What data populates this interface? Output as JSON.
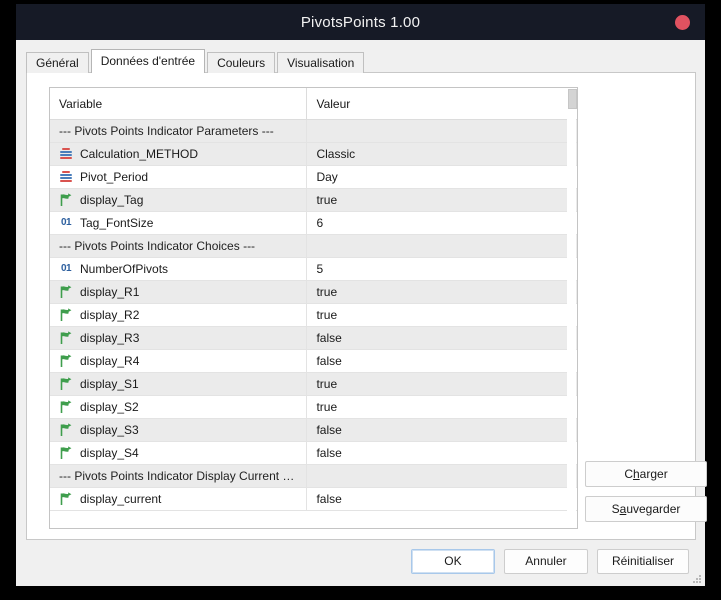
{
  "window": {
    "title": "PivotsPoints 1.00",
    "close_icon": "close-circle-icon"
  },
  "tabs": [
    {
      "label": "Général",
      "active": false
    },
    {
      "label": "Données d'entrée",
      "active": true
    },
    {
      "label": "Couleurs",
      "active": false
    },
    {
      "label": "Visualisation",
      "active": false
    }
  ],
  "grid": {
    "columns": [
      "Variable",
      "Valeur"
    ],
    "rows": [
      {
        "type": "section",
        "icon": "",
        "name": "--- Pivots Points Indicator Parameters ---",
        "value": ""
      },
      {
        "type": "enum",
        "icon": "enum-icon",
        "name": "Calculation_METHOD",
        "value": "Classic"
      },
      {
        "type": "enum",
        "icon": "enum-icon",
        "name": "Pivot_Period",
        "value": "Day"
      },
      {
        "type": "bool",
        "icon": "bool-icon",
        "name": "display_Tag",
        "value": "true"
      },
      {
        "type": "int",
        "icon": "integer-icon",
        "name": "Tag_FontSize",
        "value": "6"
      },
      {
        "type": "section",
        "icon": "",
        "name": "--- Pivots Points Indicator Choices ---",
        "value": ""
      },
      {
        "type": "int",
        "icon": "integer-icon",
        "name": "NumberOfPivots",
        "value": "5"
      },
      {
        "type": "bool",
        "icon": "bool-icon",
        "name": "display_R1",
        "value": "true"
      },
      {
        "type": "bool",
        "icon": "bool-icon",
        "name": "display_R2",
        "value": "true"
      },
      {
        "type": "bool",
        "icon": "bool-icon",
        "name": "display_R3",
        "value": "false"
      },
      {
        "type": "bool",
        "icon": "bool-icon",
        "name": "display_R4",
        "value": "false"
      },
      {
        "type": "bool",
        "icon": "bool-icon",
        "name": "display_S1",
        "value": "true"
      },
      {
        "type": "bool",
        "icon": "bool-icon",
        "name": "display_S2",
        "value": "true"
      },
      {
        "type": "bool",
        "icon": "bool-icon",
        "name": "display_S3",
        "value": "false"
      },
      {
        "type": "bool",
        "icon": "bool-icon",
        "name": "display_S4",
        "value": "false"
      },
      {
        "type": "section",
        "icon": "",
        "name": "--- Pivots Points Indicator Display Current …",
        "value": ""
      },
      {
        "type": "bool",
        "icon": "bool-icon",
        "name": "display_current",
        "value": "false"
      }
    ]
  },
  "side_buttons": [
    {
      "label": "Charger",
      "mnemonic_index": 1
    },
    {
      "label": "Sauvegarder",
      "mnemonic_index": 1
    }
  ],
  "bottom_buttons": [
    {
      "label": "OK",
      "default": true
    },
    {
      "label": "Annuler",
      "default": false
    },
    {
      "label": "Réinitialiser",
      "default": false
    }
  ],
  "colors": {
    "titlebar": "#161a26",
    "close": "#e05260",
    "dialog": "#f0f0f0",
    "accent": "#a8c8ea",
    "enum_red": "#d9534f",
    "enum_blue": "#4a7ebb",
    "bool_green": "#3f9e4d",
    "int_blue": "#2d5f9e"
  }
}
